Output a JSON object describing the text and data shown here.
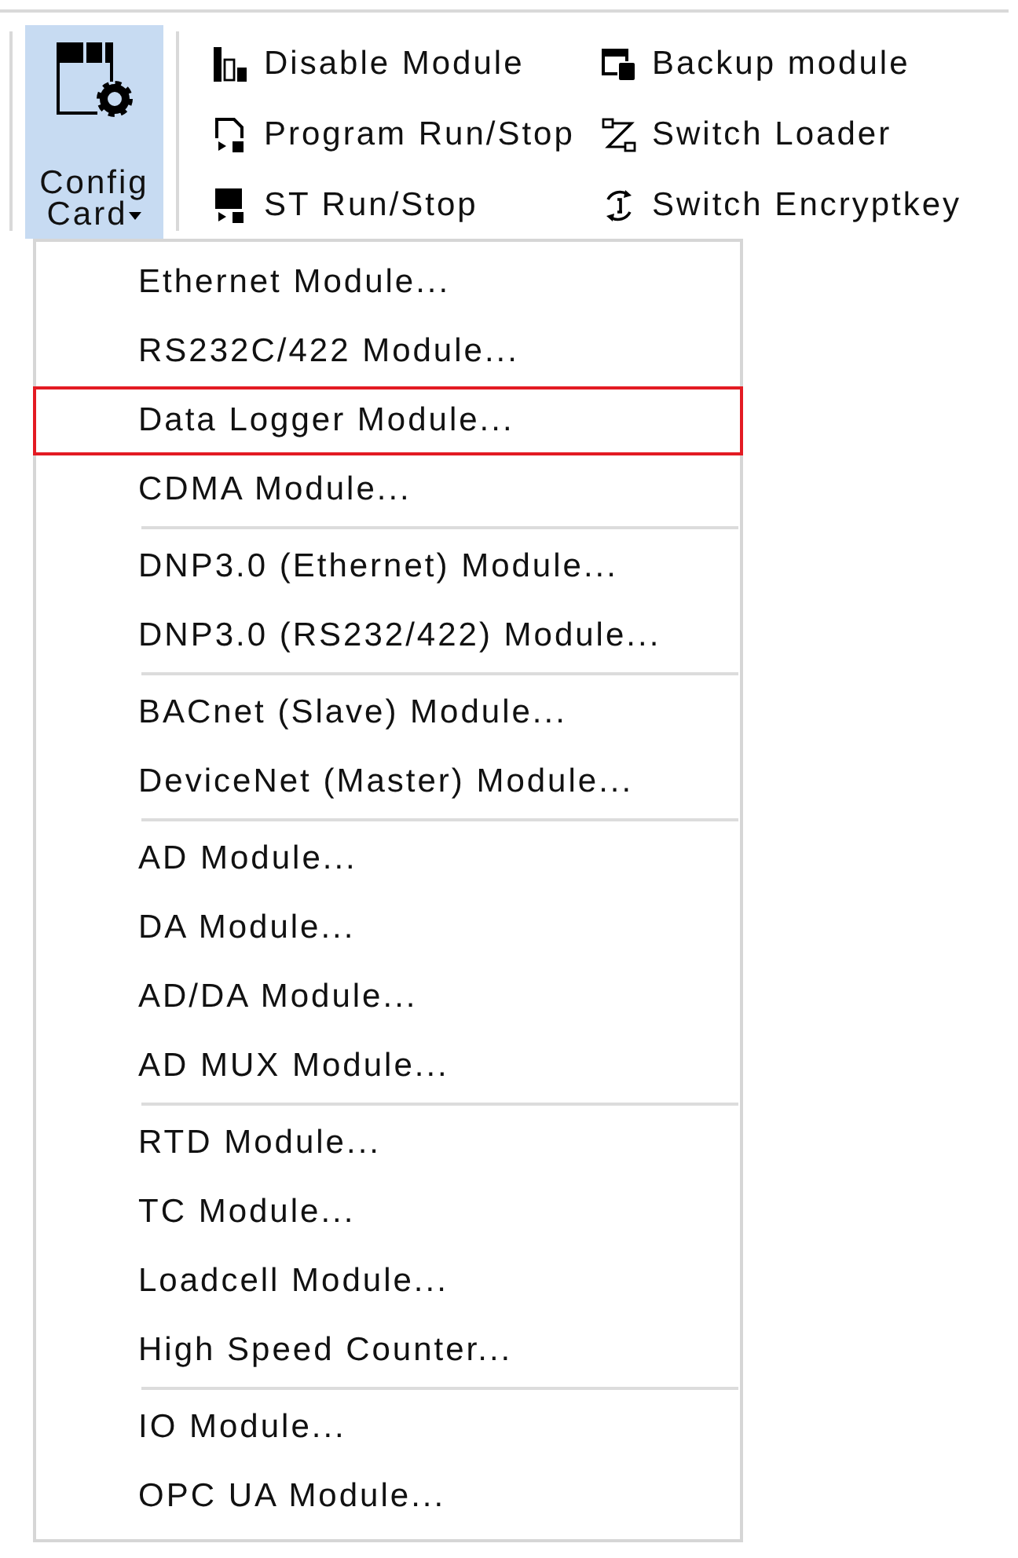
{
  "toolbar": {
    "config_card": {
      "label": "Config Card",
      "active": true
    },
    "columns": [
      {
        "items": [
          {
            "label": "Disable Module"
          },
          {
            "label": "Program Run/Stop"
          },
          {
            "label": "ST Run/Stop"
          }
        ]
      },
      {
        "items": [
          {
            "label": "Backup module"
          },
          {
            "label": "Switch Loader"
          },
          {
            "label": "Switch Encryptkey"
          }
        ]
      }
    ]
  },
  "menu": {
    "groups": [
      {
        "items": [
          {
            "label": "Ethernet Module...",
            "highlighted": false
          },
          {
            "label": "RS232C/422 Module...",
            "highlighted": false
          },
          {
            "label": "Data Logger Module...",
            "highlighted": true
          },
          {
            "label": "CDMA Module...",
            "highlighted": false
          }
        ]
      },
      {
        "items": [
          {
            "label": "DNP3.0 (Ethernet) Module...",
            "highlighted": false
          },
          {
            "label": "DNP3.0 (RS232/422) Module...",
            "highlighted": false
          }
        ]
      },
      {
        "items": [
          {
            "label": "BACnet (Slave) Module...",
            "highlighted": false
          },
          {
            "label": "DeviceNet (Master) Module...",
            "highlighted": false
          }
        ]
      },
      {
        "items": [
          {
            "label": "AD Module...",
            "highlighted": false
          },
          {
            "label": "DA Module...",
            "highlighted": false
          },
          {
            "label": "AD/DA Module...",
            "highlighted": false
          },
          {
            "label": "AD MUX Module...",
            "highlighted": false
          }
        ]
      },
      {
        "items": [
          {
            "label": "RTD Module...",
            "highlighted": false
          },
          {
            "label": "TC Module...",
            "highlighted": false
          },
          {
            "label": "Loadcell Module...",
            "highlighted": false
          },
          {
            "label": "High Speed Counter...",
            "highlighted": false
          }
        ]
      },
      {
        "items": [
          {
            "label": "IO Module...",
            "highlighted": false
          },
          {
            "label": "OPC UA Module...",
            "highlighted": false
          }
        ]
      }
    ]
  }
}
